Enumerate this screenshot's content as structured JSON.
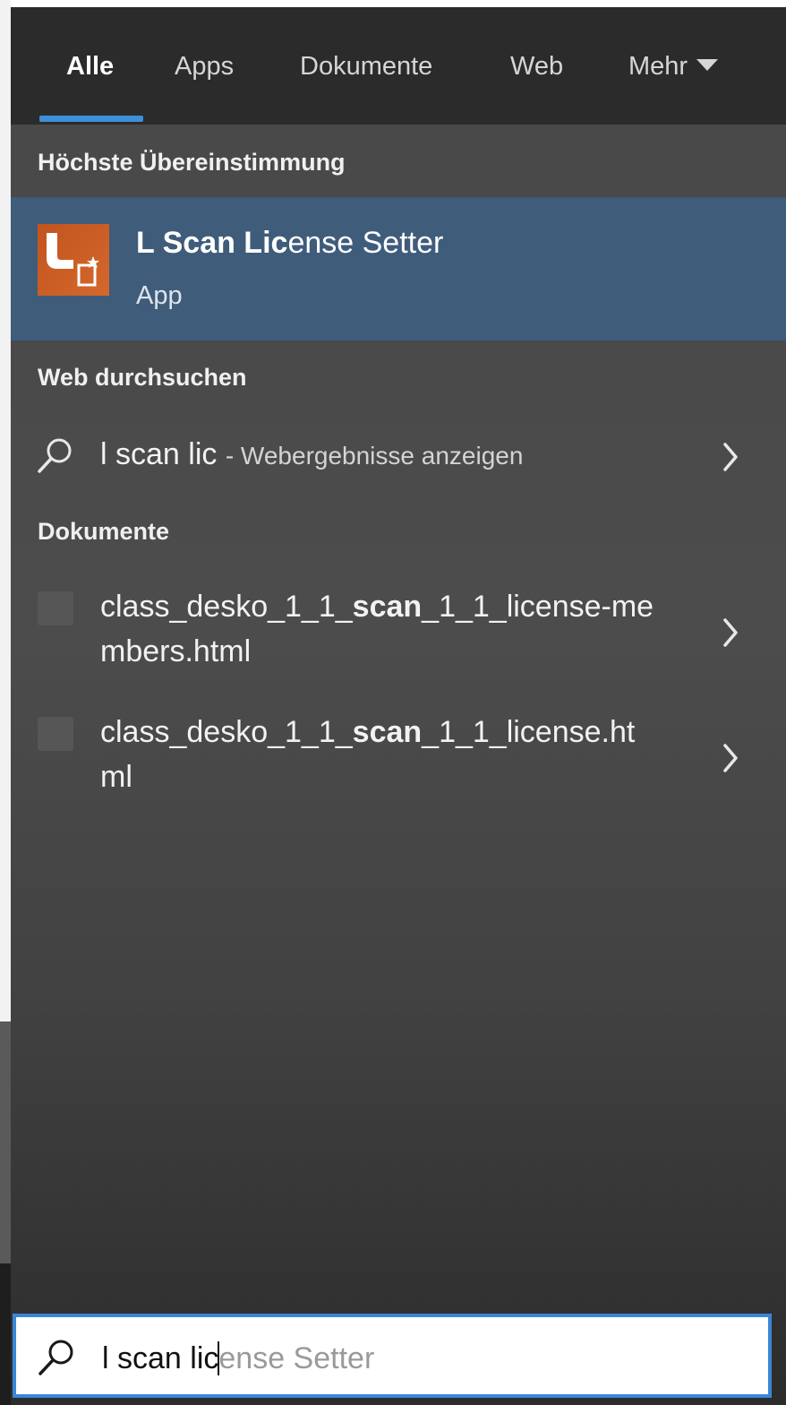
{
  "tabs": [
    {
      "label": "Alle",
      "active": true
    },
    {
      "label": "Apps",
      "active": false
    },
    {
      "label": "Dokumente",
      "active": false
    },
    {
      "label": "Web",
      "active": false
    },
    {
      "label": "Mehr",
      "active": false
    }
  ],
  "colors": {
    "accent": "#3e8fd8",
    "selected_row": "#3f5c7b",
    "app_icon": "#c2541e",
    "tabbar_bg": "#2b2b2b"
  },
  "best_match": {
    "section_label": "Höchste Übereinstimmung",
    "title_bold": "L Scan Lic",
    "title_rest": "ense Setter",
    "subtitle": "App",
    "icon": "app-icon-l-scan"
  },
  "web_search": {
    "section_label": "Web durchsuchen",
    "query": "l scan lic",
    "suffix": "- Webergebnisse anzeigen",
    "icon": "search-icon"
  },
  "documents": {
    "section_label": "Dokumente",
    "items": [
      {
        "pre": "class_desko_1_1_",
        "bold": "scan",
        "post": "_1_1_license-members.html"
      },
      {
        "pre": "class_desko_1_1_",
        "bold": "scan",
        "post": "_1_1_license.html"
      }
    ]
  },
  "search_box": {
    "typed": "l scan lic",
    "suggestion": "ense Setter",
    "icon": "search-icon"
  }
}
